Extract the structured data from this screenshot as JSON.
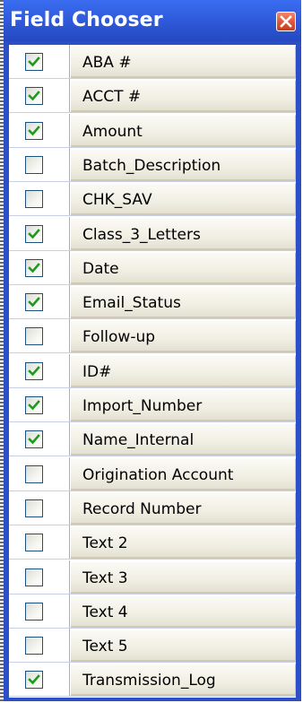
{
  "window": {
    "title": "Field Chooser"
  },
  "fields": [
    {
      "label": "ABA #",
      "checked": true
    },
    {
      "label": "ACCT #",
      "checked": true
    },
    {
      "label": "Amount",
      "checked": true
    },
    {
      "label": "Batch_Description",
      "checked": false
    },
    {
      "label": "CHK_SAV",
      "checked": false
    },
    {
      "label": "Class_3_Letters",
      "checked": true
    },
    {
      "label": "Date",
      "checked": true
    },
    {
      "label": "Email_Status",
      "checked": true
    },
    {
      "label": "Follow-up",
      "checked": false
    },
    {
      "label": "ID#",
      "checked": true
    },
    {
      "label": "Import_Number",
      "checked": true
    },
    {
      "label": "Name_Internal",
      "checked": true
    },
    {
      "label": "Origination Account",
      "checked": false
    },
    {
      "label": "Record Number",
      "checked": false
    },
    {
      "label": "Text 2",
      "checked": false
    },
    {
      "label": "Text 3",
      "checked": false
    },
    {
      "label": "Text 4",
      "checked": false
    },
    {
      "label": "Text 5",
      "checked": false
    },
    {
      "label": "Transmission_Log",
      "checked": true
    }
  ],
  "colors": {
    "titlebar": "#2e58d8",
    "check": "#1f9a1f",
    "close": "#de5437"
  },
  "icons": {
    "close": "close-icon",
    "check": "checkmark-icon"
  }
}
